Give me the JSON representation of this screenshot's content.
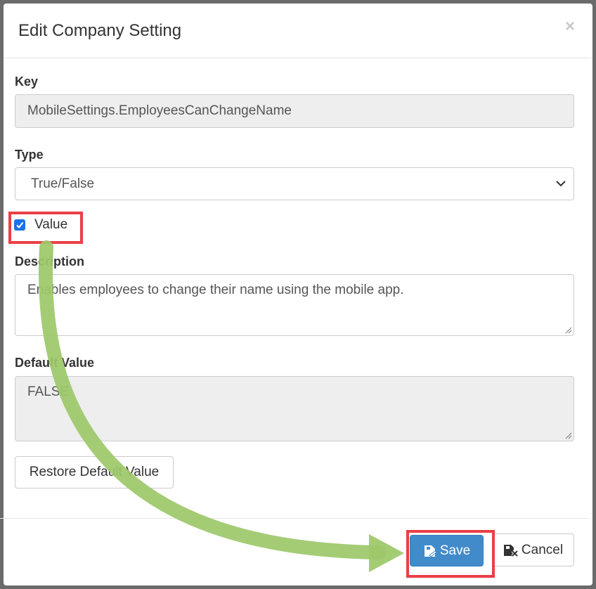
{
  "modal": {
    "title": "Edit Company Setting",
    "close_symbol": "×"
  },
  "form": {
    "key_label": "Key",
    "key_value": "MobileSettings.EmployeesCanChangeName",
    "type_label": "Type",
    "type_selected": "True/False",
    "value_label": "Value",
    "value_checked": true,
    "description_label": "Description",
    "description_value": "Enables employees to change their name using the mobile app.",
    "default_label": "Default Value",
    "default_value": "FALSE",
    "restore_button": "Restore Default Value"
  },
  "footer": {
    "save_label": "Save",
    "cancel_label": "Cancel"
  },
  "icons": {
    "close": "close-icon",
    "chevron": "chevron-down-icon",
    "check": "checkmark-icon",
    "save": "save-icon",
    "cancel": "cancel-icon"
  },
  "colors": {
    "primary": "#428bca",
    "highlight": "#e94047",
    "arrow": "#9dc86a",
    "checkbox": "#1a73e8"
  }
}
